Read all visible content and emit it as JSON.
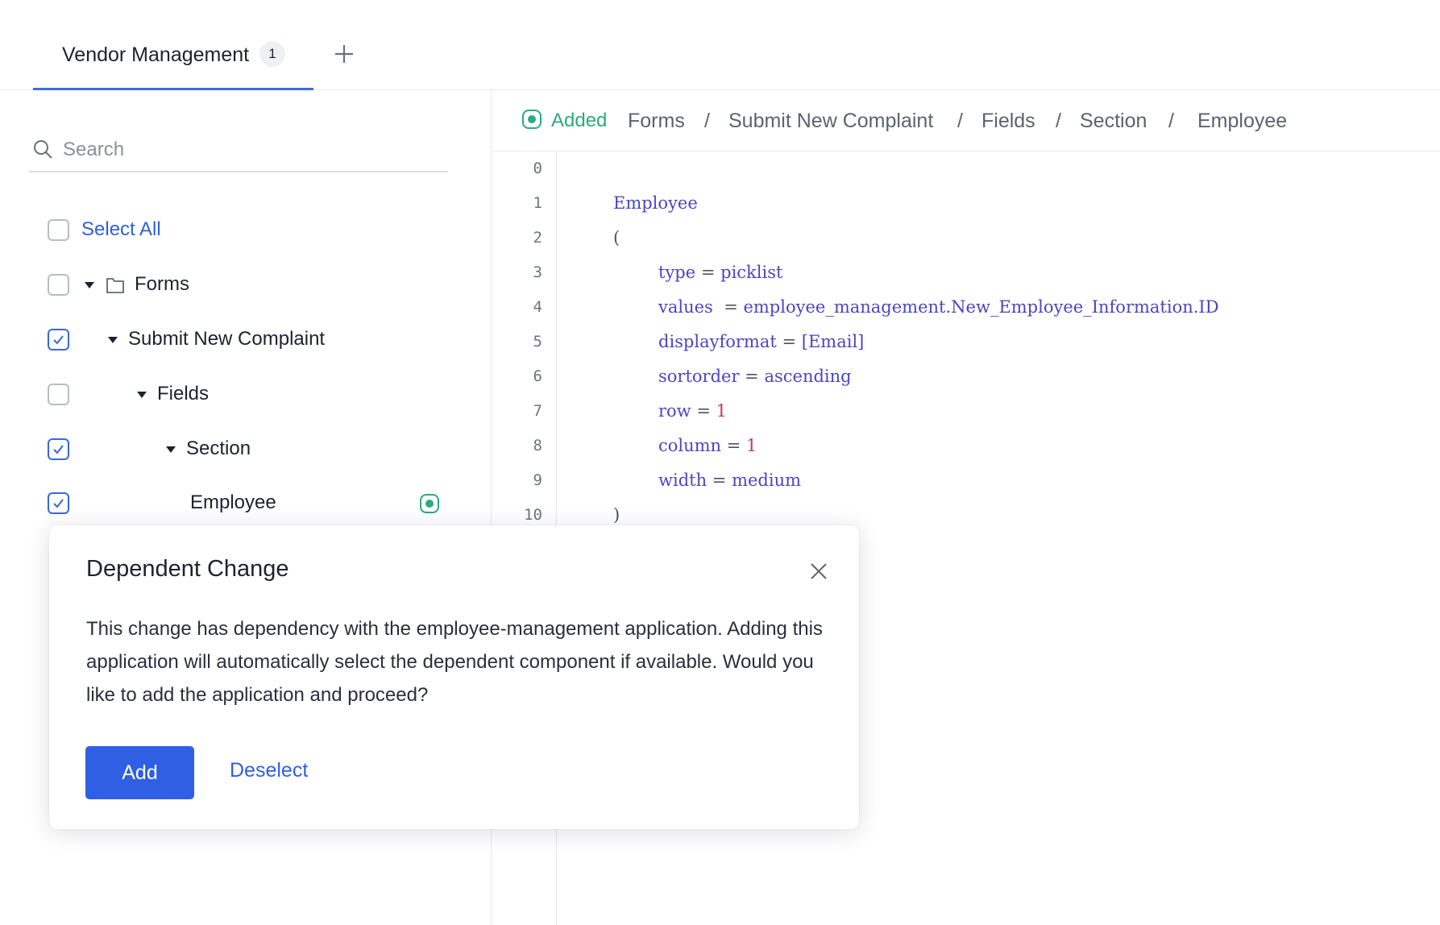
{
  "tabs": [
    {
      "label": "Vendor Management",
      "badge": "1"
    }
  ],
  "sidebar": {
    "search_placeholder": "Search",
    "select_all_label": "Select All",
    "tree": [
      {
        "label": "Forms",
        "checked": false
      },
      {
        "label": "Submit New Complaint",
        "checked": true
      },
      {
        "label": "Fields",
        "checked": false
      },
      {
        "label": "Section",
        "checked": true
      },
      {
        "label": "Employee",
        "checked": true,
        "status": "added"
      }
    ]
  },
  "breadcrumb": {
    "status_label": "Added",
    "items": [
      "Forms",
      "Submit New Complaint",
      "Fields",
      "Section",
      "Employee"
    ],
    "separator": "/"
  },
  "code": {
    "line_numbers": [
      "0",
      "1",
      "2",
      "3",
      "4",
      "5",
      "6",
      "7",
      "8",
      "9",
      "10"
    ],
    "lines": {
      "l1": "Employee",
      "l2": "(",
      "l3_key": "type",
      "l3_val": "picklist",
      "l4_key": "values",
      "l4_val": "employee_management.New_Employee_Information.ID",
      "l5_key": "displayformat",
      "l5_val": "[Email]",
      "l6_key": "sortorder",
      "l6_val": "ascending",
      "l7_key": "row",
      "l7_val": "1",
      "l8_key": "column",
      "l8_val": "1",
      "l9_key": "width",
      "l9_val": "medium",
      "l10": ")"
    }
  },
  "modal": {
    "title": "Dependent Change",
    "body": "This change has dependency with the employee-management application. Adding this application will automatically select the dependent component if available. Would you like to add the application and proceed?",
    "primary_label": "Add",
    "secondary_label": "Deselect"
  },
  "colors": {
    "accent": "#2f5fe3",
    "added_green": "#2bab7c",
    "code_keyword": "#4a45c6",
    "code_number": "#c7365f"
  }
}
